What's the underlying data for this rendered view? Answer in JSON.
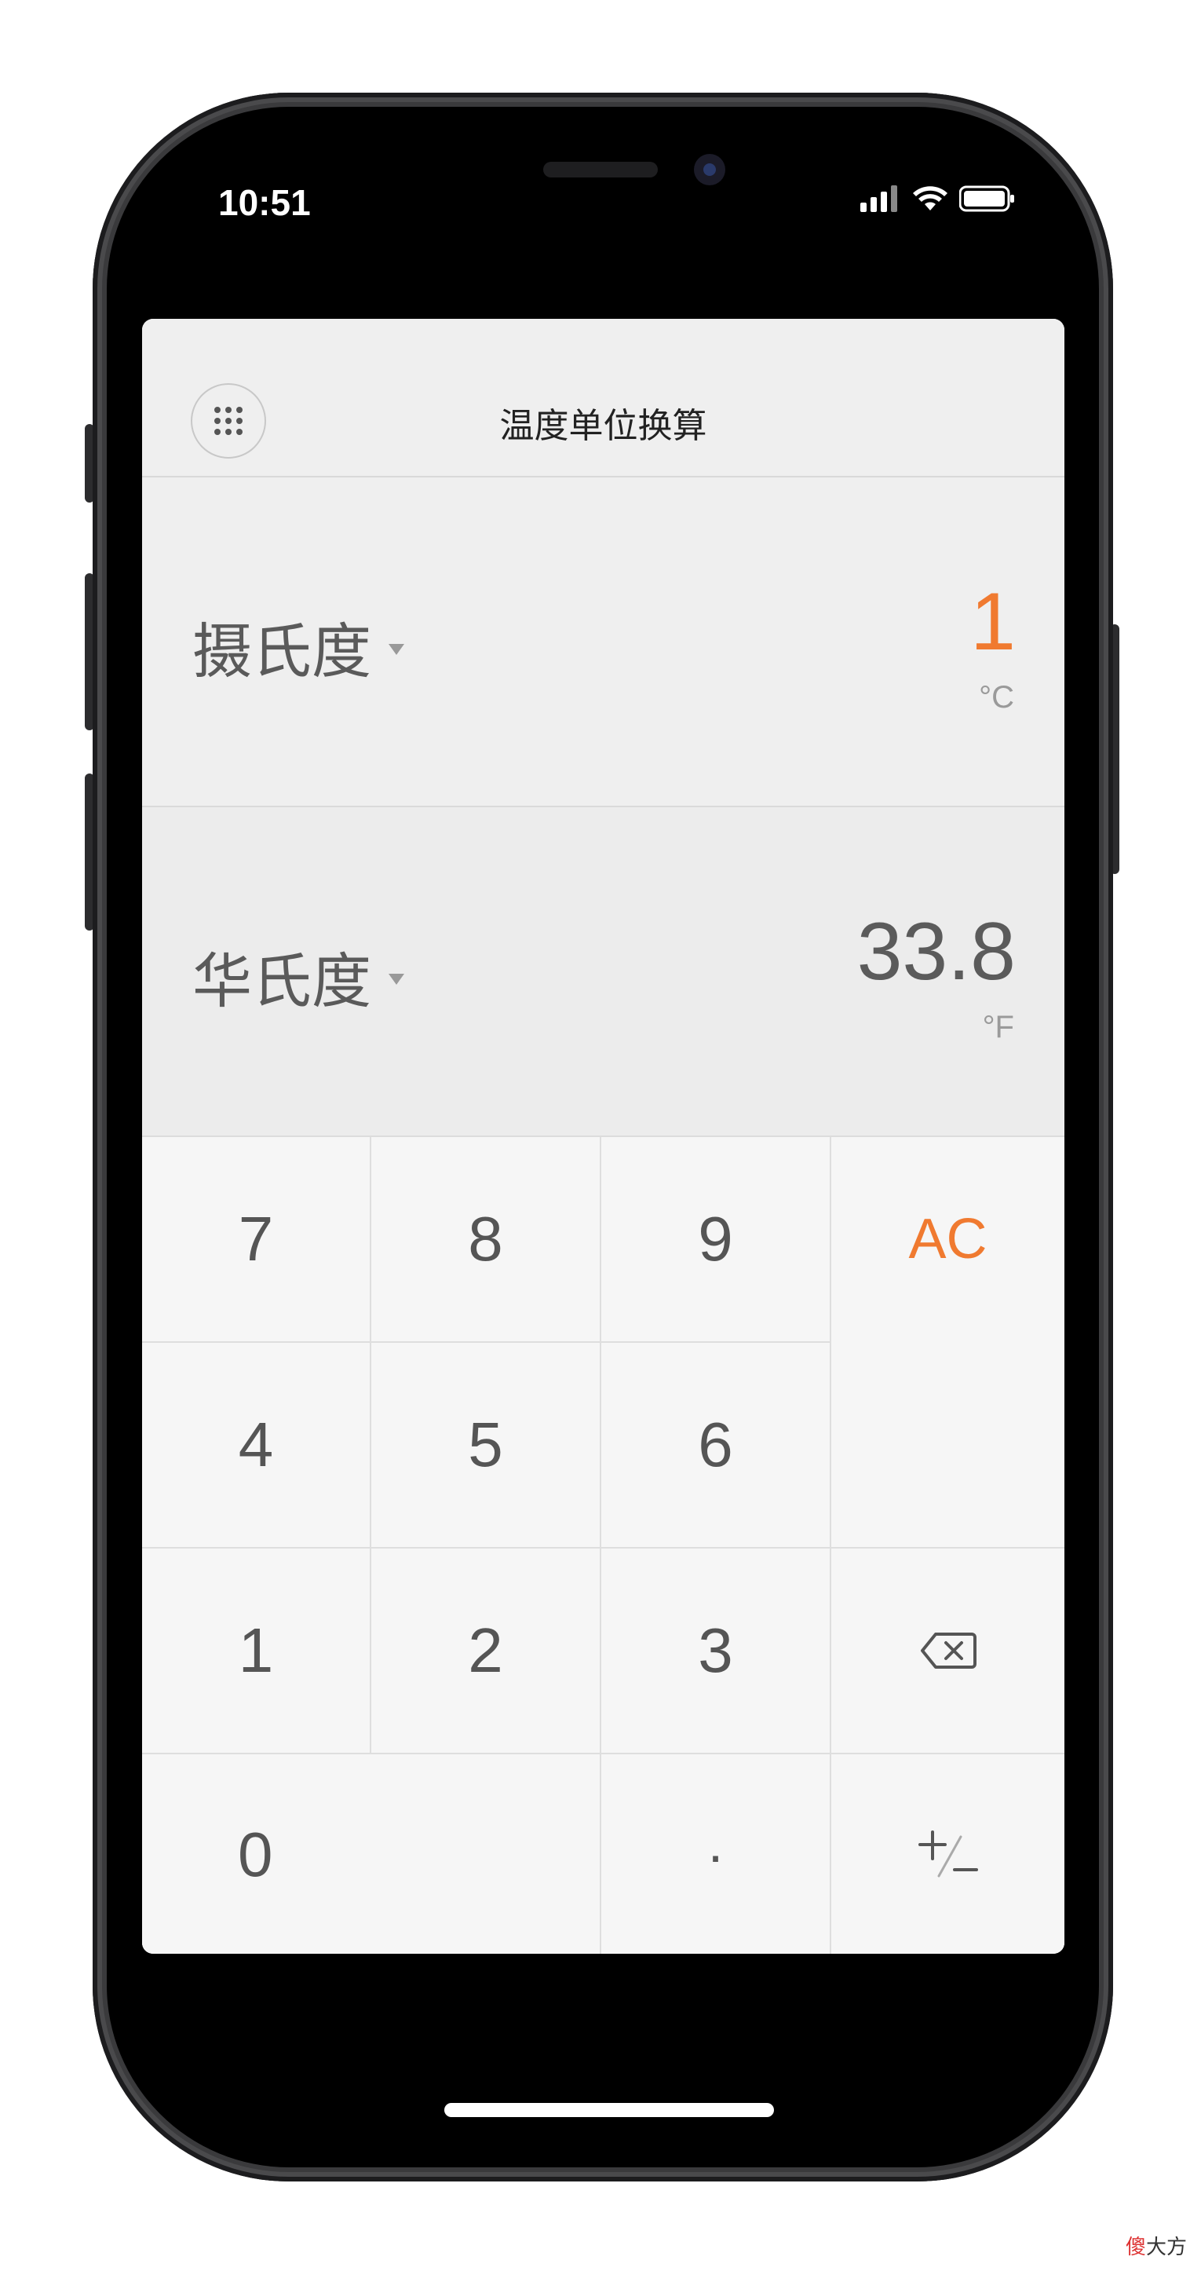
{
  "status_bar": {
    "time": "10:51",
    "icons": [
      "cellular-signal-icon",
      "wifi-icon",
      "battery-icon"
    ]
  },
  "header": {
    "title": "温度单位换算",
    "menu_icon": "grid-menu-icon"
  },
  "rows": [
    {
      "unit_name": "摄氏度",
      "value": "1",
      "symbol": "°C",
      "active": true
    },
    {
      "unit_name": "华氏度",
      "value": "33.8",
      "symbol": "°F",
      "active": false
    }
  ],
  "keypad": {
    "k7": "7",
    "k8": "8",
    "k9": "9",
    "ac": "AC",
    "k4": "4",
    "k5": "5",
    "k6": "6",
    "k1": "1",
    "k2": "2",
    "k3": "3",
    "backspace_icon": "backspace-icon",
    "k0": "0",
    "dot": "·",
    "sign_icon": "plus-minus-icon"
  },
  "colors": {
    "accent": "#f07a30",
    "text": "#555555",
    "background": "#efefef"
  },
  "watermark": {
    "part1": "傻",
    "part2": "大方"
  }
}
